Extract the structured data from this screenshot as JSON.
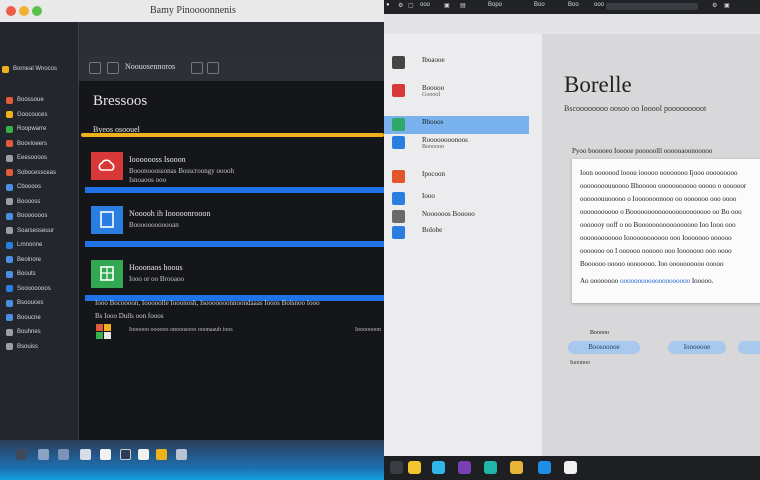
{
  "window": {
    "title": "Bamy Pinoooonnenis"
  },
  "left": {
    "sidebar_header": "Borneal Wnocos",
    "sidebar_items": [
      {
        "label": "Boossoue",
        "color": "#e25c3c"
      },
      {
        "label": "Goocouces",
        "color": "#f0b21c"
      },
      {
        "label": "Roopwarre",
        "color": "#38b14a"
      },
      {
        "label": "Boovioeers",
        "color": "#e25c3c"
      },
      {
        "label": "Eeesoooos",
        "color": "#9aa0a8"
      },
      {
        "label": "Sobocessceas",
        "color": "#e25c3c"
      },
      {
        "label": "Cboooos",
        "color": "#4a90e2"
      },
      {
        "label": "Booooss",
        "color": "#9aa0a8"
      },
      {
        "label": "Booooooos",
        "color": "#4a90e2"
      },
      {
        "label": "Soarsesseuur",
        "color": "#9aa0a8"
      },
      {
        "label": "Lrnnonne",
        "color": "#2a7de1"
      },
      {
        "label": "Beolnore",
        "color": "#4a90e2"
      },
      {
        "label": "Boouts",
        "color": "#4a90e2"
      },
      {
        "label": "Soooooooos",
        "color": "#2a7de1"
      },
      {
        "label": "Bsoouces",
        "color": "#4a90e2"
      },
      {
        "label": "Booucne",
        "color": "#4a90e2"
      },
      {
        "label": "Bouhnes",
        "color": "#9aa0a8"
      },
      {
        "label": "Bsouiss",
        "color": "#9aa0a8"
      }
    ],
    "toolbar_label": "Noouosennoros",
    "panel_title": "Bressoos",
    "section_label": "Byeos osoouel",
    "cards": [
      {
        "title": "Iooooooss Isooon",
        "subtitle": "Booonooossonas Bosscroongy ooooh",
        "extra": "Isnoaoos ooo",
        "thumb_color": "#d93838",
        "icon": "cloud-icon"
      },
      {
        "title": "Nooooh ih Iooooonrooon",
        "subtitle": "Boooooooooooan",
        "extra": "",
        "thumb_color": "#2a7de1",
        "icon": "document-icon"
      },
      {
        "title": "Hooonaos hoous",
        "subtitle": "Iooo or oo Brooaoo",
        "extra": "",
        "thumb_color": "#32a852",
        "icon": "sheet-icon"
      }
    ],
    "footer_line1": "Iooo Bocoooon, Iooooolle Iooonosh, Isooooooonnoondaaas Iooos Bolsnoo Iooo",
    "footer_line2": "Bs Iooo  Dulls oon fooos",
    "footer_line3": "Ioooooo oooooo onooosooo ooonaauh ioos",
    "footer_line4": "Iooooooon"
  },
  "right": {
    "topbar_items": [
      "ooo",
      "Bopo",
      "Boo",
      "Boo",
      "ooo"
    ],
    "sidebar_items": [
      {
        "label": "Iboaooe",
        "sub": "",
        "color": "#444444"
      },
      {
        "label": "Booooo",
        "sub": "Gooool",
        "color": "#d93838"
      },
      {
        "label": "Bhooos",
        "sub": "",
        "color": "#2fa86a"
      },
      {
        "label": "Roooooooonoos",
        "sub": "Boooooo",
        "color": "#2a7de1"
      },
      {
        "label": "Ipocoon",
        "sub": "",
        "color": "#e2562c"
      },
      {
        "label": "Iooo",
        "sub": "",
        "color": "#2a7de1"
      },
      {
        "label": "Noooooos Booooo",
        "sub": "",
        "color": "#6a6a6a"
      },
      {
        "label": "Bolobe",
        "sub": "",
        "color": "#2a7de1"
      }
    ],
    "doc_title": "Borelle",
    "doc_subtitle": "Bscoooooooo oosoo oo Iooool pooooooooot",
    "doc_label": "Pyoo booooeo Iooooe pooooolll oooooaoonooooo",
    "doc_lines": [
      "Ioon ooooood looou iooooo oooooooo Ijooo ooooooooo",
      "oooooooouuoooo Bhooooo ooooooooooo ooooo o oooooor",
      "oooooouuooooo o Iooooooonooo oo ooooooo ooo oooo",
      "ooooooooooo o Booooooooooooooooooooooo oo Bo ooo",
      "ooooooy ooff o oo Booooooooooooooooo Ioo Iooo ooo",
      "oooooooooooo Ioooooooooooo ooo Iooooooo oooooo",
      "ooooooo oo I oooooo oooooo ooo Iooooooo ooo oooo",
      "Boooooo ooooo oooooooo. Ioo oooooooooo ooooo"
    ],
    "doc_last_prefix": "Ao oooooooo",
    "doc_link": "oooooooooooooooooooo",
    "doc_last_suffix": "Iooooo.",
    "small_label": "Booooo",
    "pills": [
      "Boosooooe",
      "Iooooooe",
      ""
    ],
    "doc_footer": "Iuoonoo"
  }
}
